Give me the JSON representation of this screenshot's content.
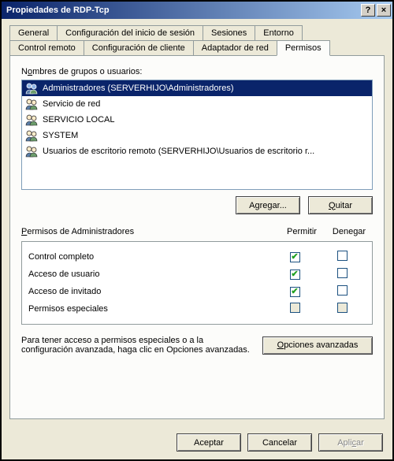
{
  "title": "Propiedades de RDP-Tcp",
  "titlebar": {
    "help": "?",
    "close": "×"
  },
  "tabs": {
    "row1": [
      {
        "label": "General"
      },
      {
        "label": "Configuración del inicio de sesión"
      },
      {
        "label": "Sesiones"
      },
      {
        "label": "Entorno"
      }
    ],
    "row2": [
      {
        "label": "Control remoto"
      },
      {
        "label": "Configuración de cliente"
      },
      {
        "label": "Adaptador de red"
      },
      {
        "label": "Permisos",
        "active": true
      }
    ]
  },
  "groups": {
    "label_pre": "N",
    "label_ul": "o",
    "label_post": "mbres de grupos o usuarios:",
    "items": [
      {
        "text": "Administradores (SERVERHIJO\\Administradores)",
        "selected": true
      },
      {
        "text": "Servicio de red"
      },
      {
        "text": "SERVICIO LOCAL"
      },
      {
        "text": "SYSTEM"
      },
      {
        "text": "Usuarios de escritorio remoto (SERVERHIJO\\Usuarios de escritorio r..."
      }
    ]
  },
  "buttons": {
    "add_pre": "Agre",
    "add_ul": "g",
    "add_post": "ar...",
    "remove_ul": "Q",
    "remove_post": "uitar",
    "advanced_ul": "O",
    "advanced_post": "pciones avanzadas",
    "ok": "Aceptar",
    "cancel": "Cancelar",
    "apply_pre": "Apli",
    "apply_ul": "c",
    "apply_post": "ar"
  },
  "perm": {
    "header_pre": "",
    "header_ul": "P",
    "header_post": "ermisos de Administradores",
    "allow": "Permitir",
    "deny": "Denegar",
    "rows": [
      {
        "label": "Control completo",
        "allow": true,
        "deny": false,
        "disabled": false
      },
      {
        "label": "Acceso de usuario",
        "allow": true,
        "deny": false,
        "disabled": false
      },
      {
        "label": "Acceso de invitado",
        "allow": true,
        "deny": false,
        "disabled": false
      },
      {
        "label": "Permisos especiales",
        "allow": false,
        "deny": false,
        "disabled": true
      }
    ]
  },
  "adv_text": "Para tener acceso a permisos especiales o a la configuración avanzada, haga clic en Opciones avanzadas."
}
